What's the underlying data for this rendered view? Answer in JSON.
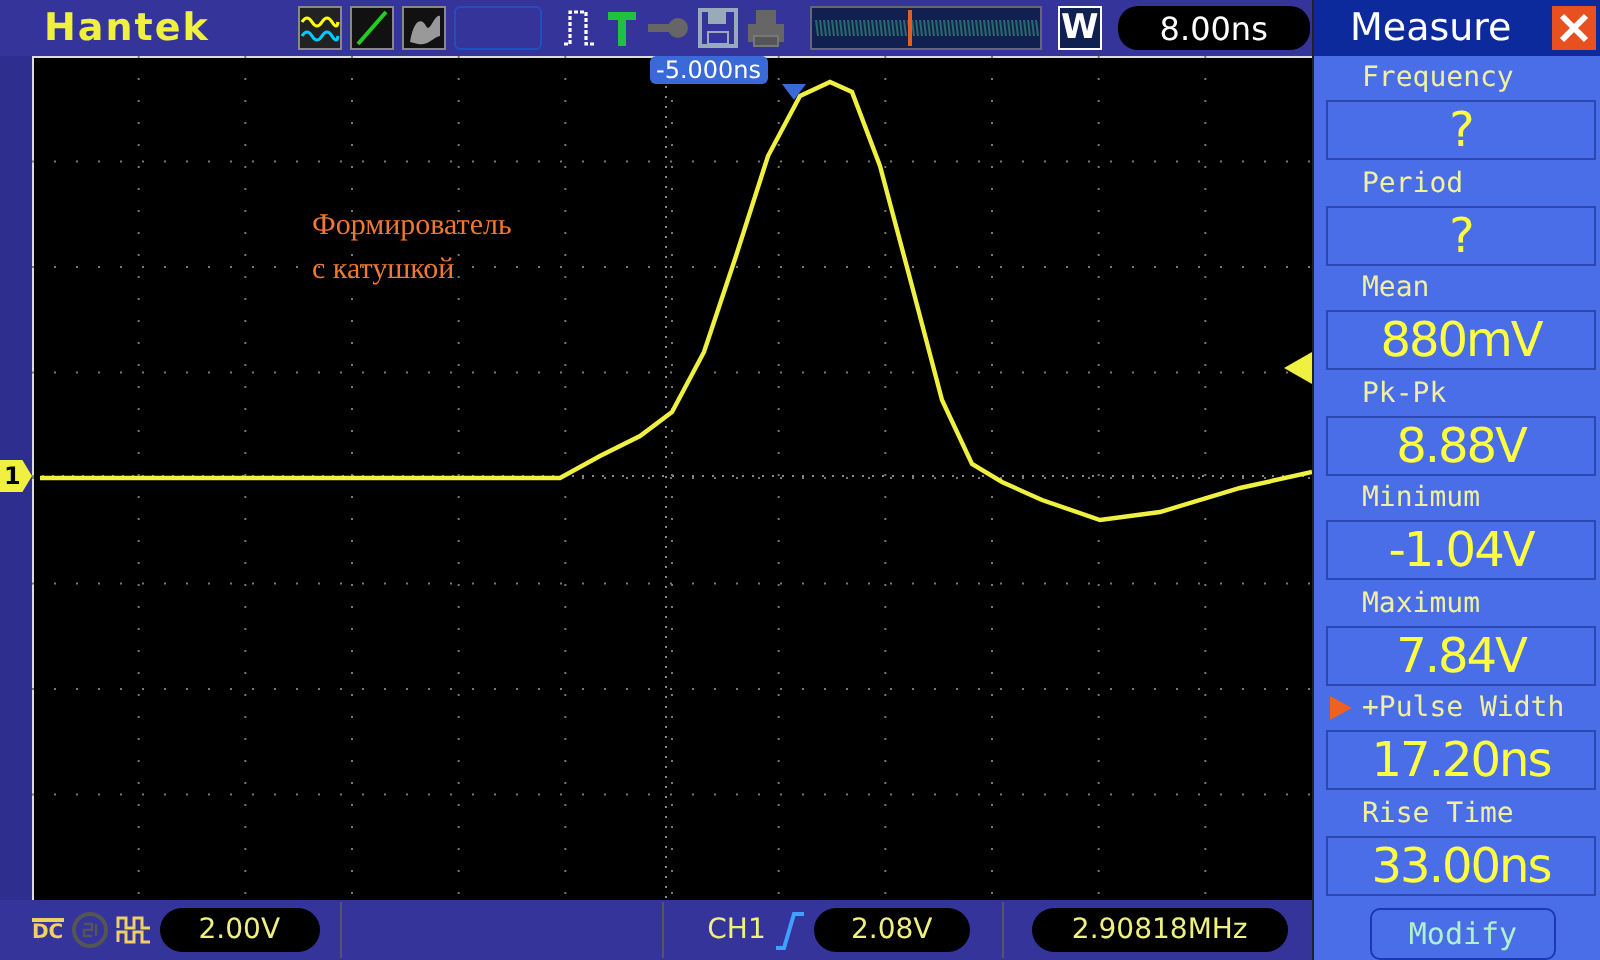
{
  "header": {
    "logo": "Hantek",
    "trigger_position": "-5.000ns",
    "window_mode": "W",
    "timebase": "8.00ns"
  },
  "screen": {
    "annotation_lines": [
      "Формирователь",
      "с катушкой"
    ],
    "channel_marker": "1"
  },
  "measure_panel": {
    "title": "Measure",
    "items": [
      {
        "label": "Frequency",
        "value": "?",
        "selected": false
      },
      {
        "label": "Period",
        "value": "?",
        "selected": false
      },
      {
        "label": "Mean",
        "value": "880mV",
        "selected": false
      },
      {
        "label": "Pk-Pk",
        "value": "8.88V",
        "selected": false
      },
      {
        "label": "Minimum",
        "value": "-1.04V",
        "selected": false
      },
      {
        "label": "Maximum",
        "value": "7.84V",
        "selected": false
      },
      {
        "label": "+Pulse Width",
        "value": "17.20ns",
        "selected": true
      },
      {
        "label": "Rise Time",
        "value": "33.00ns",
        "selected": false
      }
    ],
    "modify_button": "Modify"
  },
  "status_bar": {
    "coupling": "DC",
    "volts_per_div": "2.00V",
    "trigger_source": "CH1",
    "trigger_level": "2.08V",
    "frequency": "2.90818MHz"
  }
}
